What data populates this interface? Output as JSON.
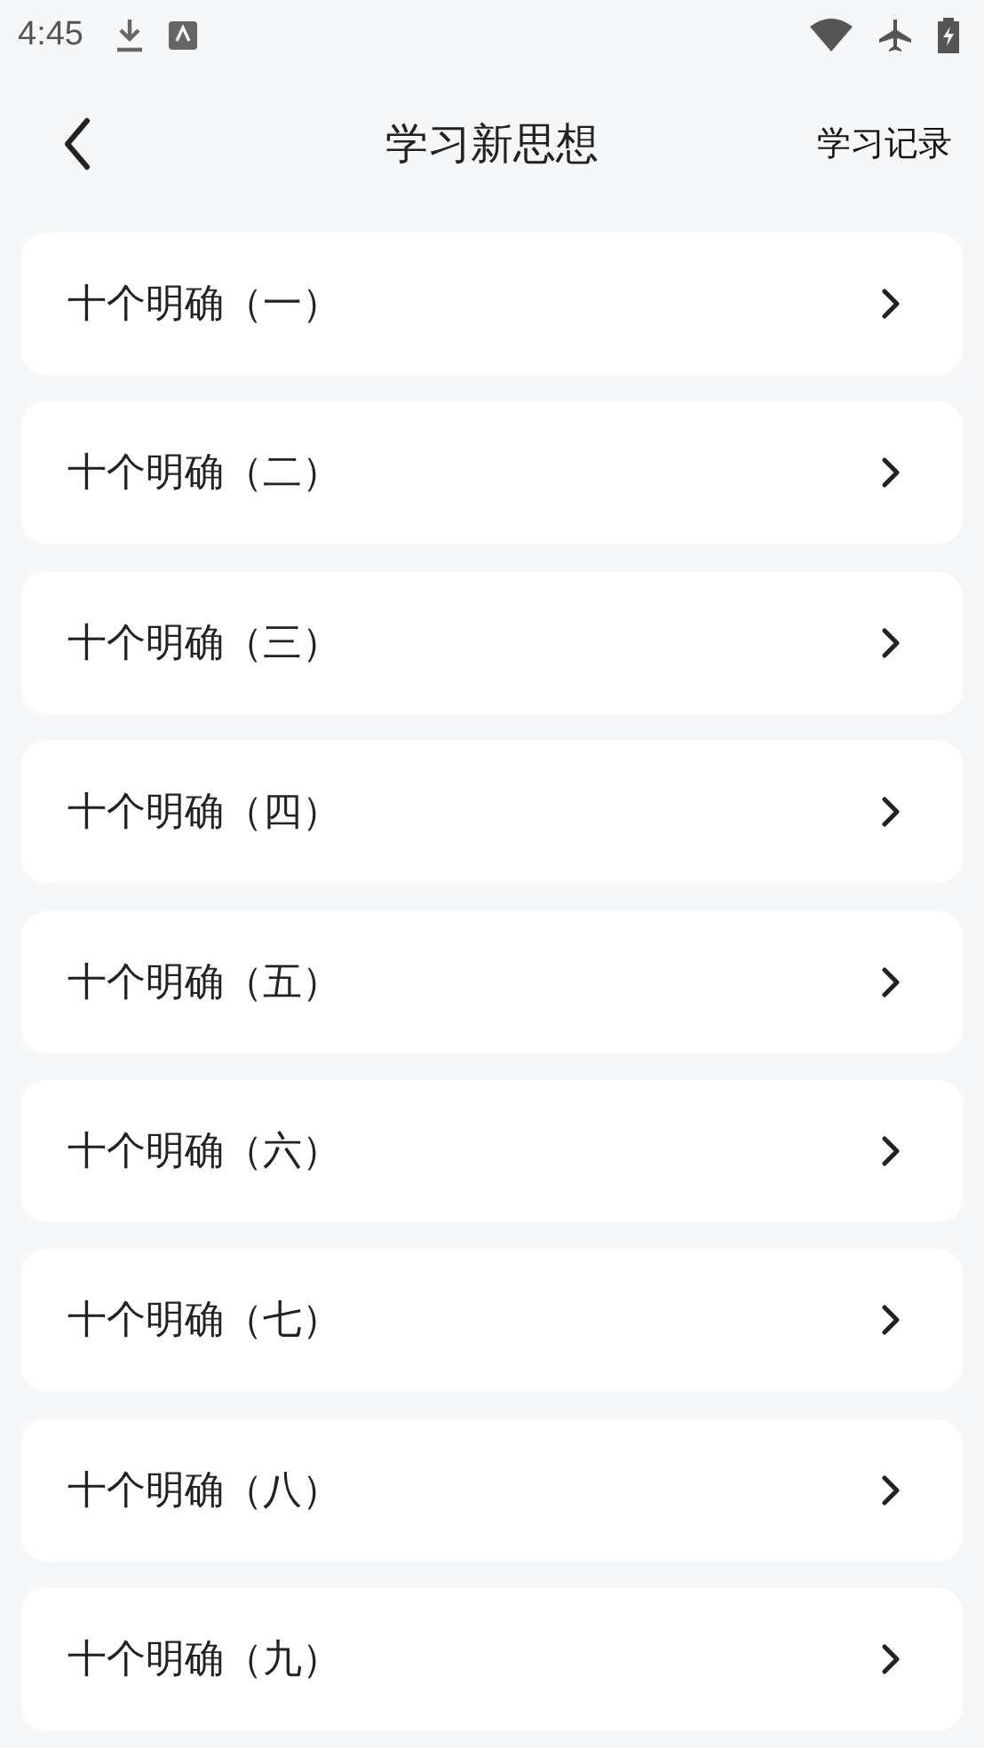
{
  "status_bar": {
    "time": "4:45"
  },
  "header": {
    "title": "学习新思想",
    "action": "学习记录"
  },
  "items": [
    {
      "label": "十个明确（一）"
    },
    {
      "label": "十个明确（二）"
    },
    {
      "label": "十个明确（三）"
    },
    {
      "label": "十个明确（四）"
    },
    {
      "label": "十个明确（五）"
    },
    {
      "label": "十个明确（六）"
    },
    {
      "label": "十个明确（七）"
    },
    {
      "label": "十个明确（八）"
    },
    {
      "label": "十个明确（九）"
    }
  ]
}
